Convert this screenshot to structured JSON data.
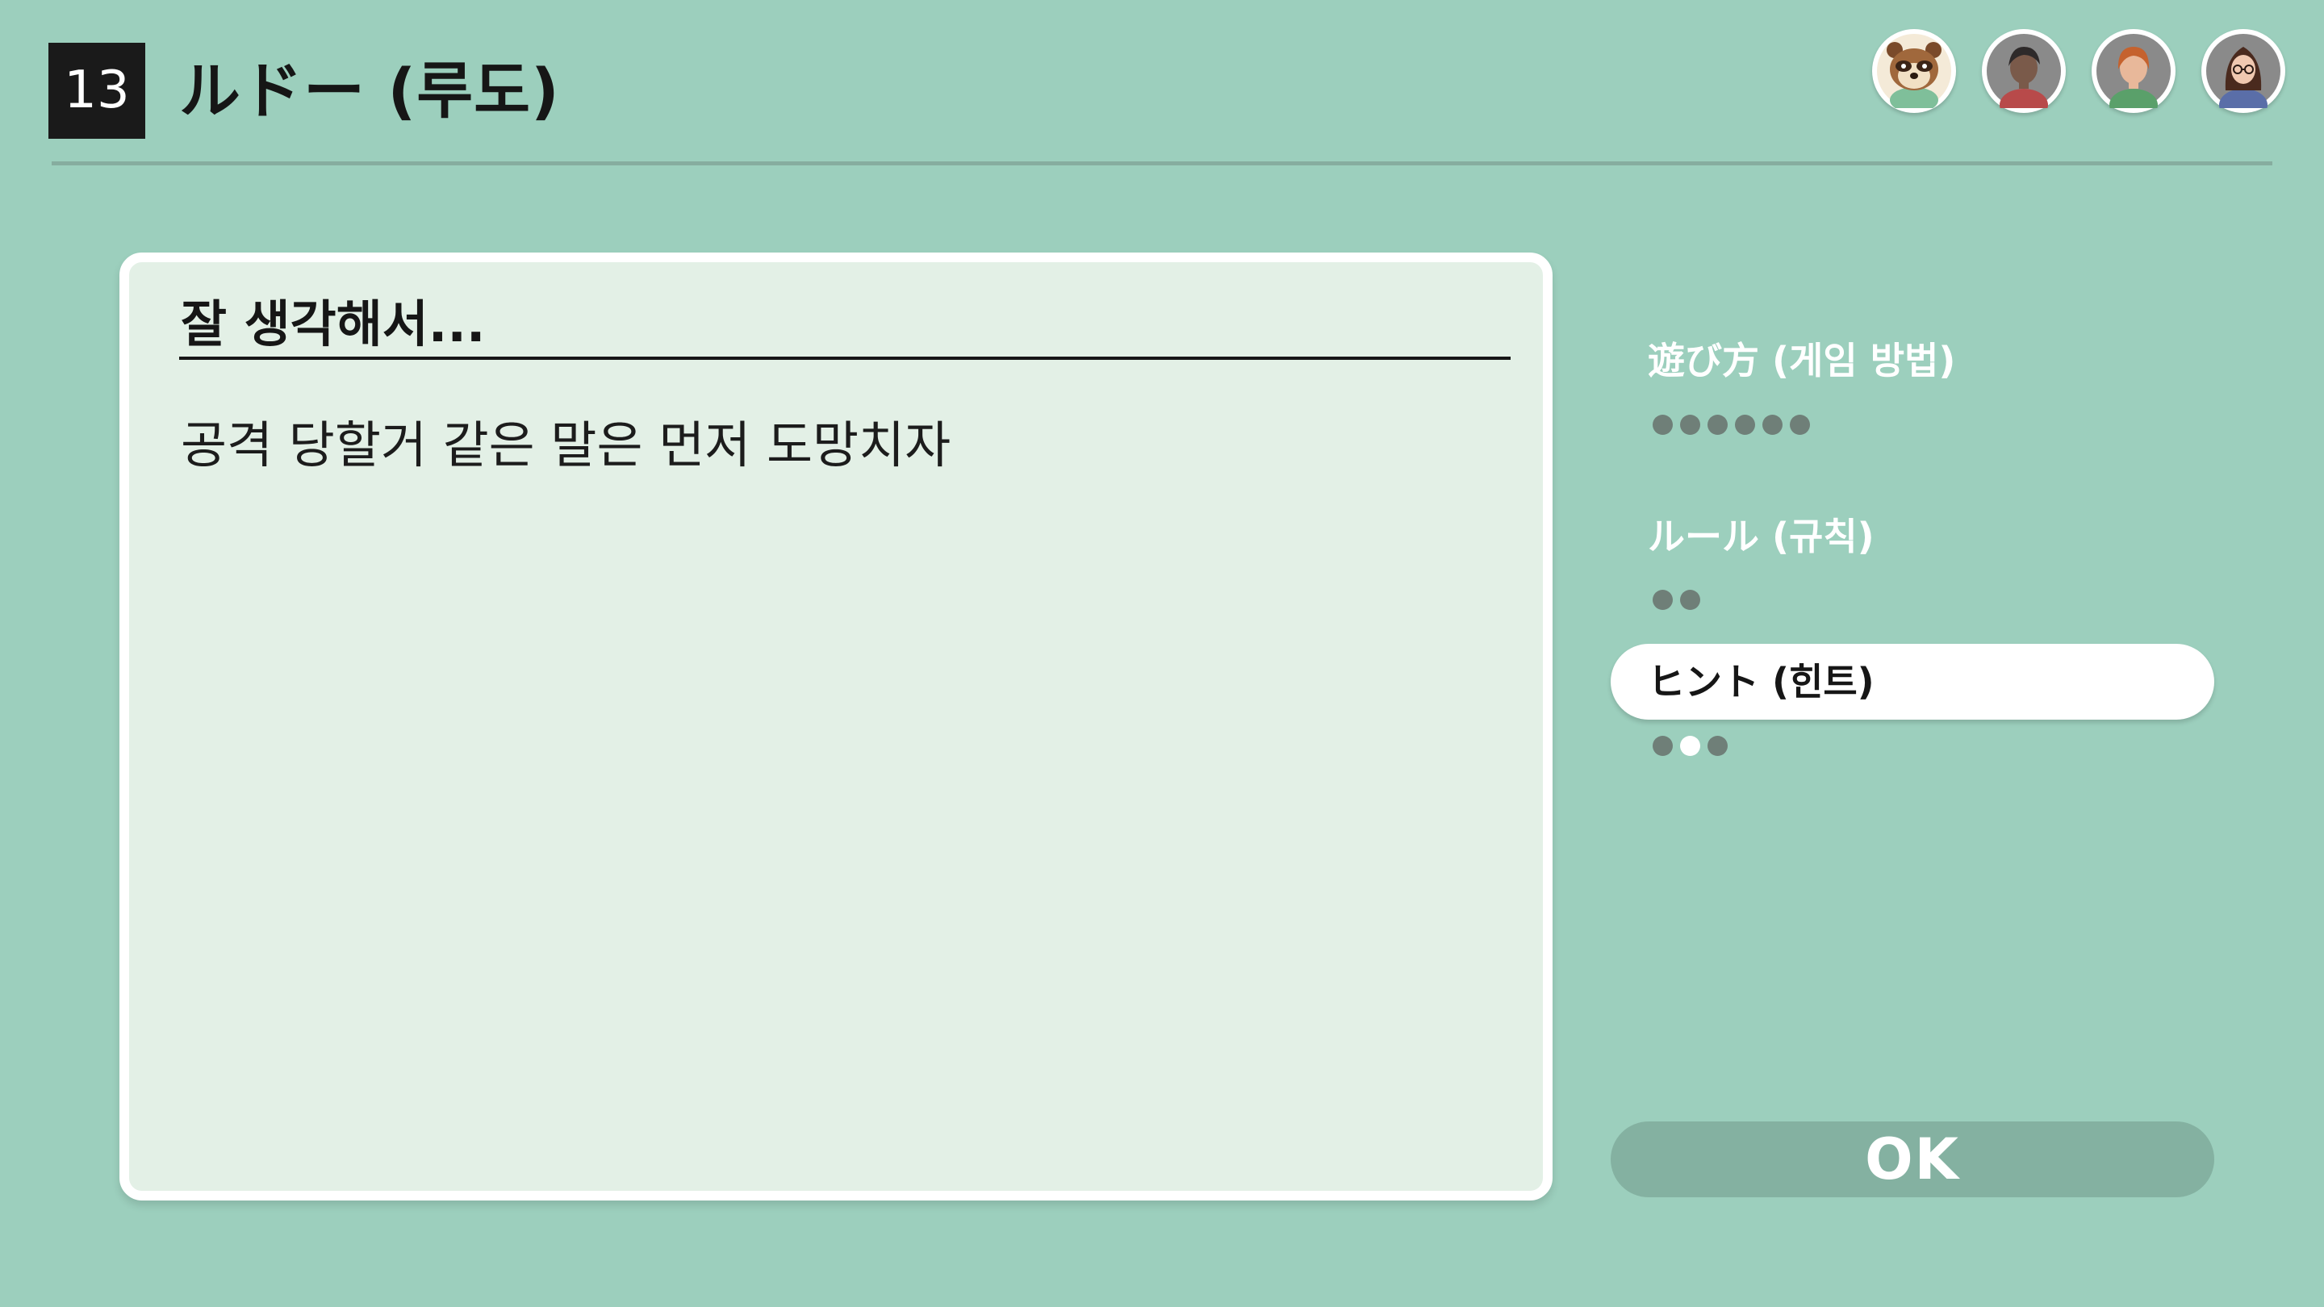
{
  "header": {
    "game_number": "13",
    "title": "ルドー (루도)"
  },
  "players": [
    {
      "icon": "tom-nook-avatar-icon"
    },
    {
      "icon": "player-avatar-dark-hair-icon"
    },
    {
      "icon": "player-avatar-orange-hair-icon"
    },
    {
      "icon": "player-avatar-glasses-icon"
    }
  ],
  "hint_card": {
    "heading": "잘 생각해서...",
    "body": "공격 당할거 같은 말은 먼저 도망치자"
  },
  "menu": {
    "items": [
      {
        "label": "遊び方 (게임 방법)",
        "pages": 6,
        "current_page": null,
        "selected": false
      },
      {
        "label": "ルール (규칙)",
        "pages": 2,
        "current_page": null,
        "selected": false
      },
      {
        "label": "ヒント (힌트)",
        "pages": 3,
        "current_page": 2,
        "selected": true
      }
    ]
  },
  "ok_button": {
    "label": "OK"
  },
  "colors": {
    "background": "#9ccfbd",
    "card": "#e3f0e6",
    "ok_button": "#84b1a1",
    "dot_inactive": "#6f7f78",
    "dot_active": "#ffffff"
  }
}
